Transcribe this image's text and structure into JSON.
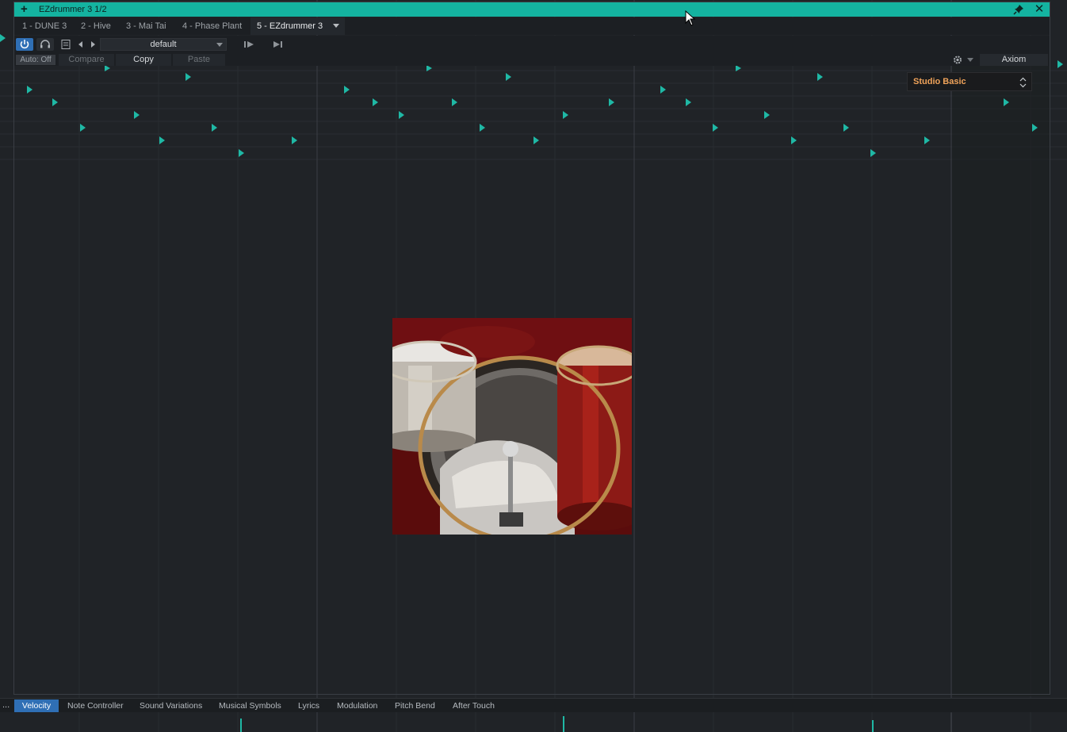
{
  "plugin_window": {
    "title": "EZdrummer 3 1/2",
    "add_symbol": "+",
    "close_symbol": "✕"
  },
  "tabs": [
    {
      "label": "1 - DUNE 3"
    },
    {
      "label": "2 - Hive"
    },
    {
      "label": "3 - Mai Tai"
    },
    {
      "label": "4 - Phase Plant"
    },
    {
      "label": "5 - EZdrummer 3"
    }
  ],
  "active_tab": "5 - EZdrummer 3",
  "toolbar": {
    "preset": "default",
    "auto_label": "Auto: Off",
    "compare_label": "Compare",
    "copy_label": "Copy",
    "paste_label": "Paste",
    "device_label": "Axiom"
  },
  "kit_selector": {
    "value": "Studio Basic"
  },
  "editor_lanes": {
    "more_label": "...",
    "tabs": [
      "Velocity",
      "Note Controller",
      "Sound Variations",
      "Musical Symbols",
      "Lyrics",
      "Modulation",
      "Pitch Bend",
      "After Touch"
    ],
    "active": "Velocity"
  },
  "colors": {
    "accent": "#14b3a0",
    "note_color": "#1fb8a5",
    "active_blue": "#2f6fb5",
    "kit_label": "#f0a35a"
  }
}
